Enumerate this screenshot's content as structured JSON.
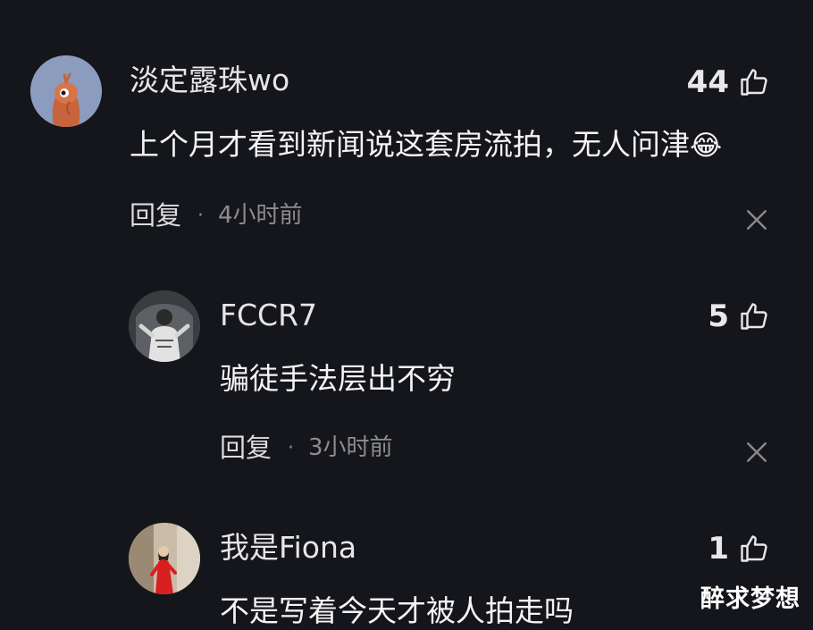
{
  "comments": [
    {
      "username": "淡定露珠wo",
      "text": "上个月才看到新闻说这套房流拍，无人问津",
      "emoji": "😂",
      "likes": "44",
      "reply_label": "回复",
      "separator": "·",
      "time": "4小时前"
    },
    {
      "username": "FCCR7",
      "text": "骗徒手法层出不穷",
      "likes": "5",
      "reply_label": "回复",
      "separator": "·",
      "time": "3小时前"
    },
    {
      "username": "我是Fiona",
      "text": "不是写着今天才被人拍走吗",
      "likes": "1"
    }
  ],
  "watermark": "醉求梦想",
  "colors": {
    "background": "#15161b",
    "avatar1_bg": "#8c9cbf",
    "avatar1_figure": "#c8643c",
    "avatar3_dress": "#d81f1f"
  }
}
